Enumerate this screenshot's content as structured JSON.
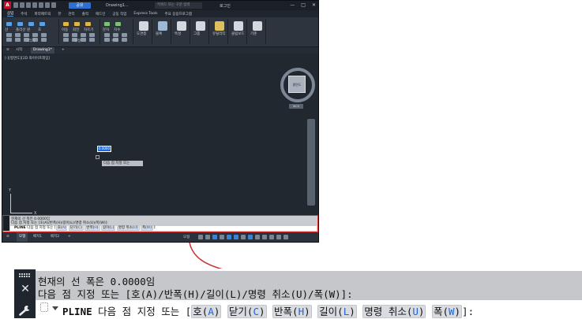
{
  "titlebar": {
    "logo": "A",
    "share_label": "공유",
    "doc_title": "Drawing1...",
    "search_placeholder": "키워드 또는 구문 입력",
    "user_label": "로그인",
    "window_controls": [
      "—",
      "□",
      "✕"
    ]
  },
  "menubar": {
    "items": [
      "삽입",
      "주석",
      "파라메트릭",
      "뷰",
      "관리",
      "출력",
      "애드인",
      "공동 작업",
      "Express Tools",
      "주요 응용프로그램"
    ],
    "active_index": 0
  },
  "ribbon": {
    "groups": [
      {
        "name": "그리기",
        "tools": [
          "선",
          "폴리선",
          "원",
          "호"
        ]
      },
      {
        "name": "수정",
        "tools": [
          "이동",
          "회전",
          "자르기"
        ]
      },
      {
        "name": "주석",
        "tools": [
          "문자",
          "치수"
        ]
      },
      {
        "name": "",
        "tools": [
          "도면층"
        ]
      },
      {
        "name": "",
        "tools": [
          "블록"
        ]
      },
      {
        "name": "",
        "tools": [
          "특성"
        ]
      },
      {
        "name": "",
        "tools": [
          "그룹"
        ]
      },
      {
        "name": "",
        "tools": [
          "유틸리티"
        ]
      },
      {
        "name": "",
        "tools": [
          "클립보드"
        ]
      },
      {
        "name": "",
        "tools": [
          "기준"
        ]
      }
    ]
  },
  "file_tabs": {
    "menu_icon": "≡",
    "tabs": [
      "시작",
      "Drawing1*"
    ],
    "active_index": 1,
    "add_label": "+"
  },
  "viewport": {
    "label": "[-][평면도][2D 와이어프레임]",
    "dynamic_input_value": "0.0000",
    "tooltip": "다음 점 지정 또는",
    "ucs_y": "Y",
    "ucs_x": "X",
    "viewcube_face": "평면도",
    "wcs_label": "WCS"
  },
  "command_line": {
    "history_line1": "현재의 선 폭은 0.0000임",
    "history_line2": "다음 점 지정 또는 [호(A)/반폭(H)/길이(L)/명령 취소(U)/폭(W)]:",
    "prompt_command": "PLINE",
    "prompt_text": "다음 점 지정 또는 [",
    "options": [
      {
        "label": "호",
        "key": "A"
      },
      {
        "label": "닫기",
        "key": "C"
      },
      {
        "label": "반폭",
        "key": "H"
      },
      {
        "label": "길이",
        "key": "L"
      },
      {
        "label": "명령 취소",
        "key": "U"
      },
      {
        "label": "폭",
        "key": "W"
      }
    ],
    "prompt_end": "]:"
  },
  "statusbar": {
    "layout_tabs": [
      "모형",
      "배치1",
      "배치2"
    ],
    "active_index": 0,
    "add_label": "+",
    "model_label": "모형"
  },
  "colors": {
    "highlight_border": "#d63030",
    "arrow": "#c73a3a",
    "option_key": "#1f63d6",
    "cad_background": "#212830"
  }
}
